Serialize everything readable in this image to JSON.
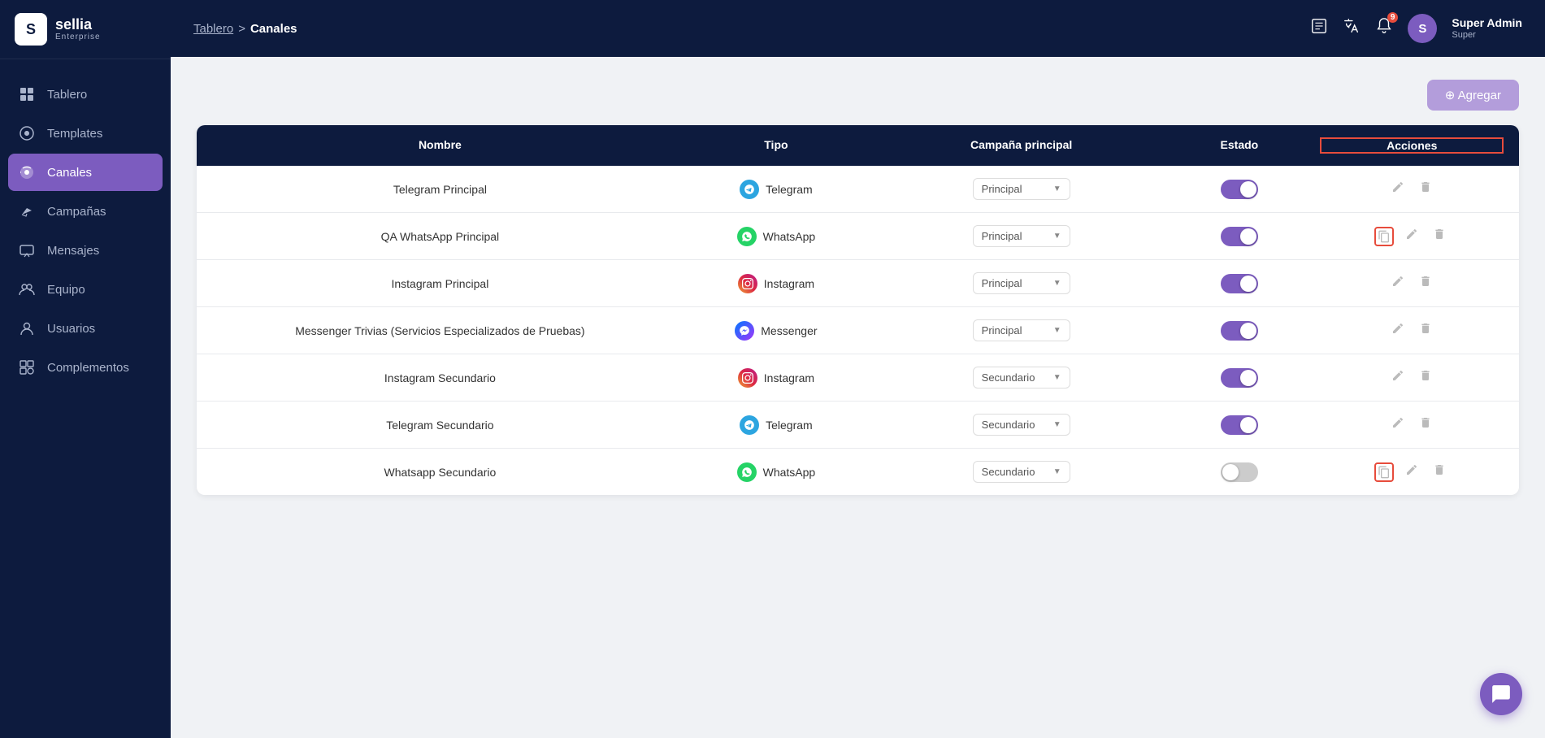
{
  "app": {
    "name": "sellia",
    "subtitle": "Enterprise"
  },
  "header": {
    "breadcrumb_link": "Tablero",
    "breadcrumb_sep": ">",
    "breadcrumb_current": "Canales",
    "icons": {
      "export": "📋",
      "translate": "🌐",
      "notification_badge": "9",
      "user_initial": "S",
      "user_name": "Super Admin",
      "user_role": "Super"
    }
  },
  "sidebar": {
    "items": [
      {
        "id": "tablero",
        "label": "Tablero",
        "icon": "⊞"
      },
      {
        "id": "templates",
        "label": "Templates",
        "icon": "💬"
      },
      {
        "id": "canales",
        "label": "Canales",
        "icon": "📡",
        "active": true
      },
      {
        "id": "campanas",
        "label": "Campañas",
        "icon": "📢"
      },
      {
        "id": "mensajes",
        "label": "Mensajes",
        "icon": "🗨"
      },
      {
        "id": "equipo",
        "label": "Equipo",
        "icon": "👥"
      },
      {
        "id": "usuarios",
        "label": "Usuarios",
        "icon": "👤"
      },
      {
        "id": "complementos",
        "label": "Complementos",
        "icon": "🧩"
      }
    ]
  },
  "table": {
    "add_button": "⊕ Agregar",
    "columns": [
      "Nombre",
      "Tipo",
      "Campaña principal",
      "Estado",
      "Acciones"
    ],
    "rows": [
      {
        "nombre": "Telegram Principal",
        "tipo": "Telegram",
        "tipo_icon": "telegram",
        "campana": "Principal",
        "estado": true,
        "copy_highlight": false
      },
      {
        "nombre": "QA WhatsApp Principal",
        "tipo": "WhatsApp",
        "tipo_icon": "whatsapp",
        "campana": "Principal",
        "estado": true,
        "copy_highlight": true
      },
      {
        "nombre": "Instagram Principal",
        "tipo": "Instagram",
        "tipo_icon": "instagram",
        "campana": "Principal",
        "estado": true,
        "copy_highlight": false
      },
      {
        "nombre": "Messenger Trivias (Servicios Especializados de Pruebas)",
        "tipo": "Messenger",
        "tipo_icon": "messenger",
        "campana": "Principal",
        "estado": true,
        "copy_highlight": false
      },
      {
        "nombre": "Instagram Secundario",
        "tipo": "Instagram",
        "tipo_icon": "instagram",
        "campana": "Secundario",
        "estado": true,
        "copy_highlight": false
      },
      {
        "nombre": "Telegram Secundario",
        "tipo": "Telegram",
        "tipo_icon": "telegram",
        "campana": "Secundario",
        "estado": true,
        "copy_highlight": false
      },
      {
        "nombre": "Whatsapp Secundario",
        "tipo": "WhatsApp",
        "tipo_icon": "whatsapp",
        "campana": "Secundario",
        "estado": false,
        "copy_highlight": true
      }
    ]
  },
  "acciones_col_label": "Acciones"
}
